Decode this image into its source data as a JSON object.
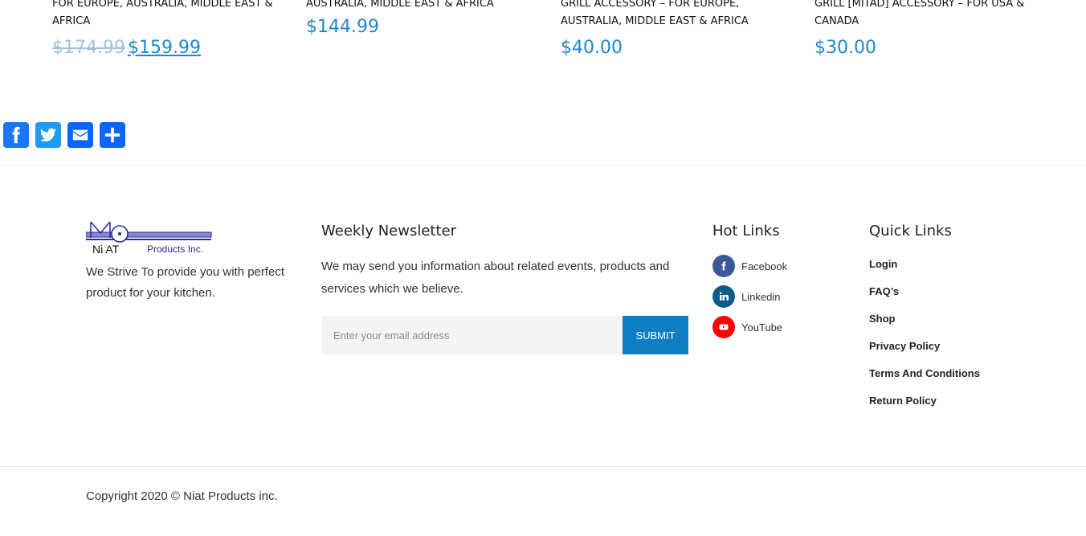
{
  "products": [
    {
      "name": "FOR EUROPE, AUSTRALIA, MIDDLE EAST & AFRICA",
      "old_price": "$174.99",
      "price": "$159.99"
    },
    {
      "name": "AUSTRALIA, MIDDLE EAST & AFRICA",
      "price": "$144.99"
    },
    {
      "name": "GRILL ACCESSORY – FOR EUROPE, AUSTRALIA, MIDDLE EAST & AFRICA",
      "price": "$40.00"
    },
    {
      "name": "GRILL [MITAD] ACCESSORY – FOR USA & CANADA",
      "price": "$30.00"
    }
  ],
  "share": {
    "icons": [
      "facebook-icon",
      "twitter-icon",
      "email-icon",
      "share-icon"
    ],
    "colors": {
      "facebook": "#1877f2",
      "twitter": "#1d9bf0",
      "email": "#0866ff"
    }
  },
  "logo": {
    "text_main": "Ni AT",
    "text_sub": "Products Inc."
  },
  "about": {
    "text": "We Strive To provide you with perfect product for your kitchen."
  },
  "newsletter": {
    "title": "Weekly Newsletter",
    "text": "We may send you information about related events, products and services which we believe.",
    "placeholder": "Enter your email address",
    "submit_label": "SUBMIT"
  },
  "hot_links": {
    "title": "Hot Links",
    "items": [
      {
        "label": "Facebook",
        "icon": "facebook-icon",
        "color": "#3b5998"
      },
      {
        "label": "Linkedin",
        "icon": "linkedin-icon",
        "color": "#0e5a8a"
      },
      {
        "label": "YouTube",
        "icon": "youtube-icon",
        "color": "#ff0000"
      }
    ]
  },
  "quick_links": {
    "title": "Quick Links",
    "items": [
      "Login",
      "FAQ’s",
      "Shop",
      "Privacy Policy",
      "Terms And Conditions",
      "Return Policy"
    ]
  },
  "copyright": "Copyright 2020 © Niat Products inc.",
  "colors": {
    "accent": "#1e88c9",
    "button": "#0e7ec4"
  }
}
